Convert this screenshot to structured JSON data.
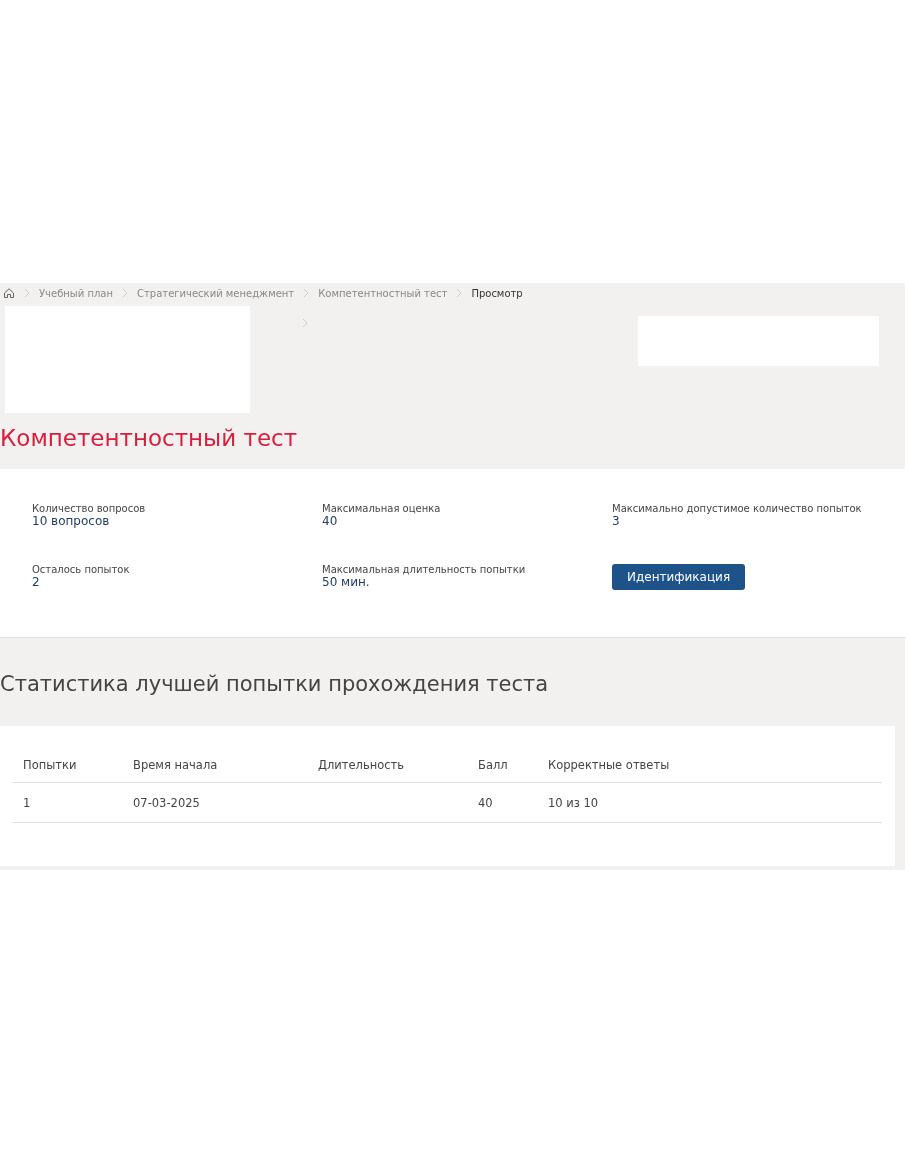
{
  "breadcrumb": [
    {
      "label": "Учебный план",
      "current": false
    },
    {
      "label": "Стратегический менеджмент",
      "current": false
    },
    {
      "label": "Компетентностный тест",
      "current": false
    },
    {
      "label": "Просмотр",
      "current": true
    }
  ],
  "title": "Компетентностный тест",
  "info": [
    {
      "label": "Количество вопросов",
      "value": "10 вопросов"
    },
    {
      "label": "Максимальная оценка",
      "value": "40"
    },
    {
      "label": "Максимально допустимое количество попыток",
      "value": "3"
    },
    {
      "label": "Осталось попыток",
      "value": "2"
    },
    {
      "label": "Максимальная длительность попытки",
      "value": "50 мин."
    }
  ],
  "identify_button": "Идентификация",
  "stats_title": "Статистика лучшей попытки прохождения теста",
  "table": {
    "columns": [
      "Попытки",
      "Время начала",
      "Длительность",
      "Балл",
      "Корректные ответы"
    ],
    "rows": [
      [
        "1",
        "07-03-2025",
        "",
        "40",
        "10 из 10"
      ]
    ]
  }
}
